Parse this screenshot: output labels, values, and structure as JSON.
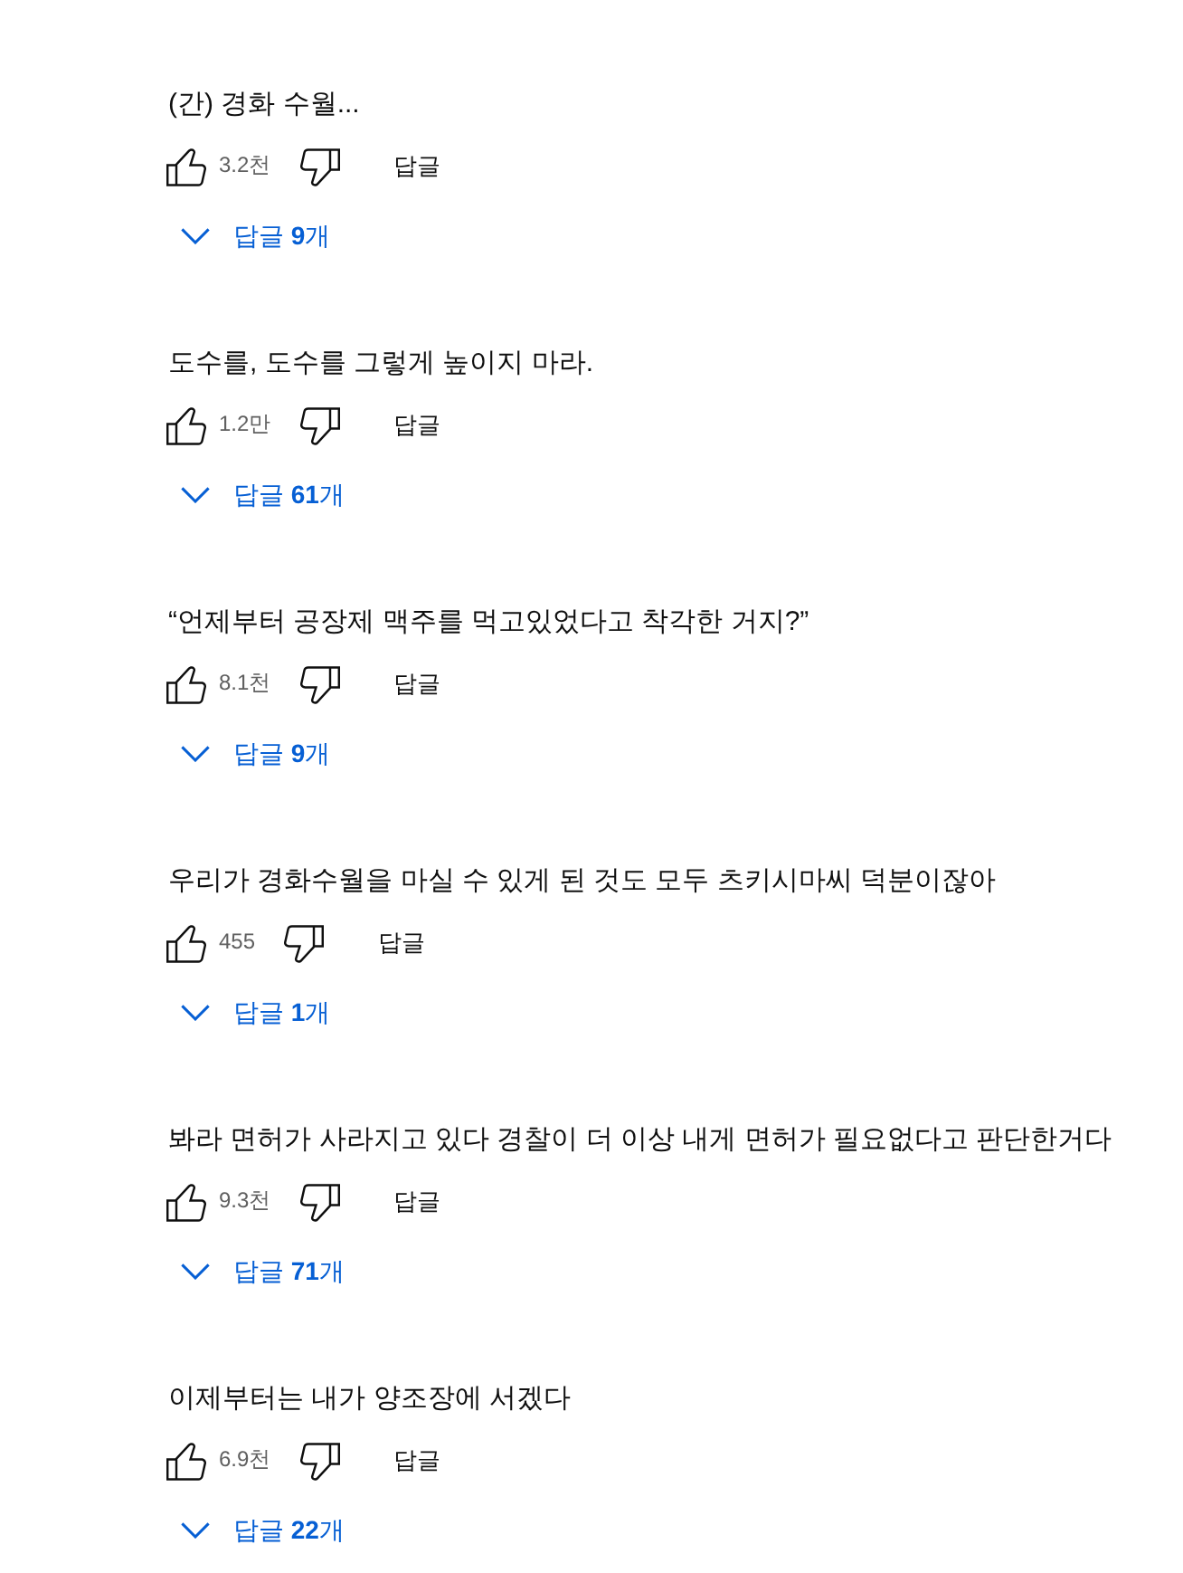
{
  "comments": [
    {
      "text": "(간) 경화 수월...",
      "like_count": "3.2천",
      "reply_button": "답글",
      "replies_toggle": "답글 **9**개"
    },
    {
      "text": "도수를, 도수를 그렇게 높이지 마라.",
      "like_count": "1.2만",
      "reply_button": "답글",
      "replies_toggle": "답글 **61**개"
    },
    {
      "text": "“언제부터 공장제 맥주를 먹고있었다고 착각한 거지?”",
      "like_count": "8.1천",
      "reply_button": "답글",
      "replies_toggle": "답글 **9**개"
    },
    {
      "text": "우리가 경화수월을 마실 수 있게 된 것도 모두 츠키시마씨 덕분이잖아",
      "like_count": "455",
      "reply_button": "답글",
      "replies_toggle": "답글 **1**개"
    },
    {
      "text": "봐라 면허가 사라지고 있다 경찰이 더 이상 내게 면허가 필요없다고 판단한거다",
      "like_count": "9.3천",
      "reply_button": "답글",
      "replies_toggle": "답글 **71**개"
    },
    {
      "text": "이제부터는 내가 양조장에 서겠다",
      "like_count": "6.9천",
      "reply_button": "답글",
      "replies_toggle": "답글 **22**개"
    }
  ]
}
